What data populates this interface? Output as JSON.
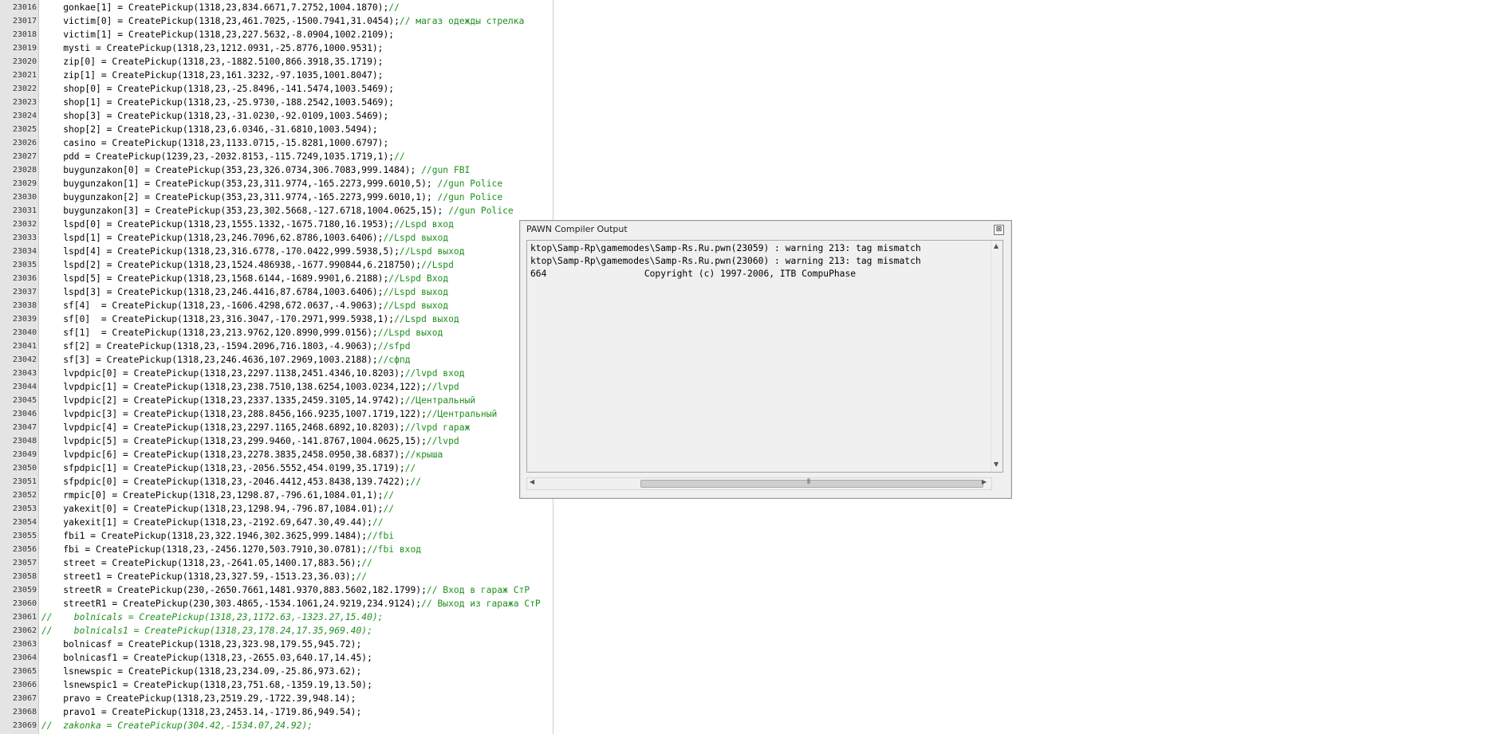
{
  "editor": {
    "lines": [
      {
        "num": "23016",
        "code": "    gonkae[1] = CreatePickup(1318,23,834.6671,7.2752,1004.1870);",
        "comment": "//"
      },
      {
        "num": "23017",
        "code": "    victim[0] = CreatePickup(1318,23,461.7025,-1500.7941,31.0454);",
        "comment": "// магаз одежды стрелка"
      },
      {
        "num": "23018",
        "code": "    victim[1] = CreatePickup(1318,23,227.5632,-8.0904,1002.2109);",
        "comment": ""
      },
      {
        "num": "23019",
        "code": "    mysti = CreatePickup(1318,23,1212.0931,-25.8776,1000.9531);",
        "comment": ""
      },
      {
        "num": "23020",
        "code": "    zip[0] = CreatePickup(1318,23,-1882.5100,866.3918,35.1719);",
        "comment": ""
      },
      {
        "num": "23021",
        "code": "    zip[1] = CreatePickup(1318,23,161.3232,-97.1035,1001.8047);",
        "comment": ""
      },
      {
        "num": "23022",
        "code": "    shop[0] = CreatePickup(1318,23,-25.8496,-141.5474,1003.5469);",
        "comment": ""
      },
      {
        "num": "23023",
        "code": "    shop[1] = CreatePickup(1318,23,-25.9730,-188.2542,1003.5469);",
        "comment": ""
      },
      {
        "num": "23024",
        "code": "    shop[3] = CreatePickup(1318,23,-31.0230,-92.0109,1003.5469);",
        "comment": ""
      },
      {
        "num": "23025",
        "code": "    shop[2] = CreatePickup(1318,23,6.0346,-31.6810,1003.5494);",
        "comment": ""
      },
      {
        "num": "23026",
        "code": "    casino = CreatePickup(1318,23,1133.0715,-15.8281,1000.6797);",
        "comment": ""
      },
      {
        "num": "23027",
        "code": "    pdd = CreatePickup(1239,23,-2032.8153,-115.7249,1035.1719,1);",
        "comment": "//"
      },
      {
        "num": "23028",
        "code": "    buygunzakon[0] = CreatePickup(353,23,326.0734,306.7083,999.1484); ",
        "comment": "//gun FBI"
      },
      {
        "num": "23029",
        "code": "    buygunzakon[1] = CreatePickup(353,23,311.9774,-165.2273,999.6010,5); ",
        "comment": "//gun Police"
      },
      {
        "num": "23030",
        "code": "    buygunzakon[2] = CreatePickup(353,23,311.9774,-165.2273,999.6010,1); ",
        "comment": "//gun Police"
      },
      {
        "num": "23031",
        "code": "    buygunzakon[3] = CreatePickup(353,23,302.5668,-127.6718,1004.0625,15); ",
        "comment": "//gun Police"
      },
      {
        "num": "23032",
        "code": "    lspd[0] = CreatePickup(1318,23,1555.1332,-1675.7180,16.1953);",
        "comment": "//Lspd вход"
      },
      {
        "num": "23033",
        "code": "    lspd[1] = CreatePickup(1318,23,246.7096,62.8786,1003.6406);",
        "comment": "//Lspd выход"
      },
      {
        "num": "23034",
        "code": "    lspd[4] = CreatePickup(1318,23,316.6778,-170.0422,999.5938,5);",
        "comment": "//Lspd выход"
      },
      {
        "num": "23035",
        "code": "    lspd[2] = CreatePickup(1318,23,1524.486938,-1677.990844,6.218750);",
        "comment": "//Lspd"
      },
      {
        "num": "23036",
        "code": "    lspd[5] = CreatePickup(1318,23,1568.6144,-1689.9901,6.2188);",
        "comment": "//Lspd Вход"
      },
      {
        "num": "23037",
        "code": "    lspd[3] = CreatePickup(1318,23,246.4416,87.6784,1003.6406);",
        "comment": "//Lspd выход"
      },
      {
        "num": "23038",
        "code": "    sf[4]  = CreatePickup(1318,23,-1606.4298,672.0637,-4.9063);",
        "comment": "//Lspd выход"
      },
      {
        "num": "23039",
        "code": "    sf[0]  = CreatePickup(1318,23,316.3047,-170.2971,999.5938,1);",
        "comment": "//Lspd выход"
      },
      {
        "num": "23040",
        "code": "    sf[1]  = CreatePickup(1318,23,213.9762,120.8990,999.0156);",
        "comment": "//Lspd выход"
      },
      {
        "num": "23041",
        "code": "    sf[2] = CreatePickup(1318,23,-1594.2096,716.1803,-4.9063);",
        "comment": "//sfpd"
      },
      {
        "num": "23042",
        "code": "    sf[3] = CreatePickup(1318,23,246.4636,107.2969,1003.2188);",
        "comment": "//сфпд"
      },
      {
        "num": "23043",
        "code": "    lvpdpic[0] = CreatePickup(1318,23,2297.1138,2451.4346,10.8203);",
        "comment": "//lvpd вход"
      },
      {
        "num": "23044",
        "code": "    lvpdpic[1] = CreatePickup(1318,23,238.7510,138.6254,1003.0234,122);",
        "comment": "//lvpd"
      },
      {
        "num": "23045",
        "code": "    lvpdpic[2] = CreatePickup(1318,23,2337.1335,2459.3105,14.9742);",
        "comment": "//Центральный"
      },
      {
        "num": "23046",
        "code": "    lvpdpic[3] = CreatePickup(1318,23,288.8456,166.9235,1007.1719,122);",
        "comment": "//Центральный"
      },
      {
        "num": "23047",
        "code": "    lvpdpic[4] = CreatePickup(1318,23,2297.1165,2468.6892,10.8203);",
        "comment": "//lvpd гараж"
      },
      {
        "num": "23048",
        "code": "    lvpdpic[5] = CreatePickup(1318,23,299.9460,-141.8767,1004.0625,15);",
        "comment": "//lvpd"
      },
      {
        "num": "23049",
        "code": "    lvpdpic[6] = CreatePickup(1318,23,2278.3835,2458.0950,38.6837);",
        "comment": "//крыша"
      },
      {
        "num": "23050",
        "code": "    sfpdpic[1] = CreatePickup(1318,23,-2056.5552,454.0199,35.1719);",
        "comment": "//"
      },
      {
        "num": "23051",
        "code": "    sfpdpic[0] = CreatePickup(1318,23,-2046.4412,453.8438,139.7422);",
        "comment": "//"
      },
      {
        "num": "23052",
        "code": "    rmpic[0] = CreatePickup(1318,23,1298.87,-796.61,1084.01,1);",
        "comment": "//"
      },
      {
        "num": "23053",
        "code": "    yakexit[0] = CreatePickup(1318,23,1298.94,-796.87,1084.01);",
        "comment": "//"
      },
      {
        "num": "23054",
        "code": "    yakexit[1] = CreatePickup(1318,23,-2192.69,647.30,49.44);",
        "comment": "//"
      },
      {
        "num": "23055",
        "code": "    fbi1 = CreatePickup(1318,23,322.1946,302.3625,999.1484);",
        "comment": "//fbi"
      },
      {
        "num": "23056",
        "code": "    fbi = CreatePickup(1318,23,-2456.1270,503.7910,30.0781);",
        "comment": "//fbi вход"
      },
      {
        "num": "23057",
        "code": "    street = CreatePickup(1318,23,-2641.05,1400.17,883.56);",
        "comment": "//"
      },
      {
        "num": "23058",
        "code": "    street1 = CreatePickup(1318,23,327.59,-1513.23,36.03);",
        "comment": "//"
      },
      {
        "num": "23059",
        "code": "    streetR = CreatePickup(230,-2650.7661,1481.9370,883.5602,182.1799);",
        "comment": "// Вход в гараж СтР"
      },
      {
        "num": "23060",
        "code": "    streetR1 = CreatePickup(230,303.4865,-1534.1061,24.9219,234.9124);",
        "comment": "// Выход из гаража СтР"
      },
      {
        "num": "23061",
        "code": "",
        "comment": "//    bolnicals = CreatePickup(1318,23,1172.63,-1323.27,15.40);",
        "italic": true
      },
      {
        "num": "23062",
        "code": "",
        "comment": "//    bolnicals1 = CreatePickup(1318,23,178.24,17.35,969.40);",
        "italic": true
      },
      {
        "num": "23063",
        "code": "    bolnicasf = CreatePickup(1318,23,323.98,179.55,945.72);",
        "comment": ""
      },
      {
        "num": "23064",
        "code": "    bolnicasf1 = CreatePickup(1318,23,-2655.03,640.17,14.45);",
        "comment": ""
      },
      {
        "num": "23065",
        "code": "    lsnewspic = CreatePickup(1318,23,234.09,-25.86,973.62);",
        "comment": ""
      },
      {
        "num": "23066",
        "code": "    lsnewspic1 = CreatePickup(1318,23,751.68,-1359.19,13.50);",
        "comment": ""
      },
      {
        "num": "23067",
        "code": "    pravo = CreatePickup(1318,23,2519.29,-1722.39,948.14);",
        "comment": ""
      },
      {
        "num": "23068",
        "code": "    pravo1 = CreatePickup(1318,23,2453.14,-1719.86,949.54);",
        "comment": ""
      },
      {
        "num": "23069",
        "code": "",
        "comment": "//  zakonka = CreatePickup(304.42,-1534.07,24.92);",
        "italic": true
      }
    ]
  },
  "dialog": {
    "title": "PAWN Compiler Output",
    "close_glyph": "⊠",
    "output_lines": [
      "ktop\\Samp-Rp\\gamemodes\\Samp-Rs.Ru.pwn(23059) : warning 213: tag mismatch",
      "ktop\\Samp-Rp\\gamemodes\\Samp-Rs.Ru.pwn(23060) : warning 213: tag mismatch",
      "664                  Copyright (c) 1997-2006, ITB CompuPhase"
    ]
  },
  "colors": {
    "comment": "#1f8f1f",
    "gutter": "#e4e4e4",
    "dialog_bg": "#f0f0f0"
  }
}
